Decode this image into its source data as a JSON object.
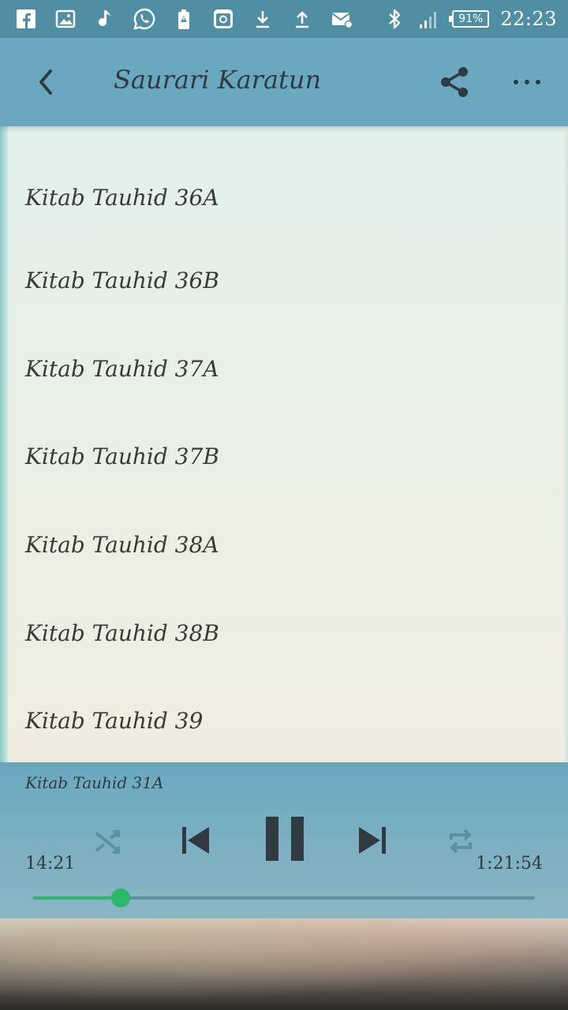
{
  "status_bar": {
    "icons": [
      "facebook-icon",
      "gallery-icon",
      "music-note-icon",
      "whatsapp-icon",
      "battery-alert-icon",
      "instagram-icon",
      "download-icon",
      "upload-icon",
      "email-settings-icon"
    ],
    "right_icons": [
      "bluetooth-icon",
      "signal-icon"
    ],
    "battery_percent": "91%",
    "time": "22:23"
  },
  "app_bar": {
    "title": "Saurari Karatun",
    "back_icon": "chevron-left-icon",
    "share_icon": "share-icon",
    "more_icon": "more-horizontal-icon"
  },
  "tracks": [
    "Kitab Tauhid 36A",
    "Kitab Tauhid 36B",
    "Kitab Tauhid 37A",
    "Kitab Tauhid 37B",
    "Kitab Tauhid 38A",
    "Kitab Tauhid 38B",
    "Kitab Tauhid 39"
  ],
  "player": {
    "now_playing": "Kitab Tauhid 31A",
    "current_time": "14:21",
    "total_time": "1:21:54",
    "progress": 0.175,
    "colors": {
      "progress": "#2db76a",
      "controls": "#2f3b41",
      "muted_controls": "#5d8fa3"
    }
  },
  "colors": {
    "status_bar": "#4f8ea3",
    "app_bar": "#6aa8c0",
    "text": "#3a3a38"
  }
}
